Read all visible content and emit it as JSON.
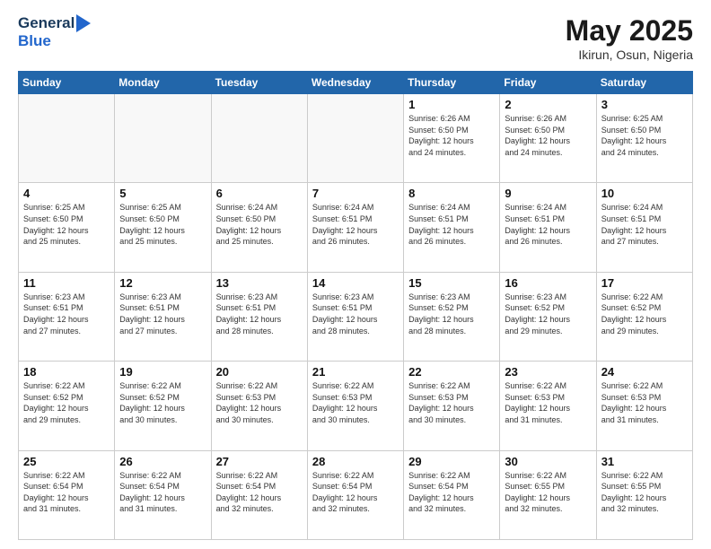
{
  "header": {
    "logo_general": "General",
    "logo_blue": "Blue",
    "month": "May 2025",
    "location": "Ikirun, Osun, Nigeria"
  },
  "days": [
    "Sunday",
    "Monday",
    "Tuesday",
    "Wednesday",
    "Thursday",
    "Friday",
    "Saturday"
  ],
  "weeks": [
    [
      {
        "date": "",
        "info": ""
      },
      {
        "date": "",
        "info": ""
      },
      {
        "date": "",
        "info": ""
      },
      {
        "date": "",
        "info": ""
      },
      {
        "date": "1",
        "info": "Sunrise: 6:26 AM\nSunset: 6:50 PM\nDaylight: 12 hours\nand 24 minutes."
      },
      {
        "date": "2",
        "info": "Sunrise: 6:26 AM\nSunset: 6:50 PM\nDaylight: 12 hours\nand 24 minutes."
      },
      {
        "date": "3",
        "info": "Sunrise: 6:25 AM\nSunset: 6:50 PM\nDaylight: 12 hours\nand 24 minutes."
      }
    ],
    [
      {
        "date": "4",
        "info": "Sunrise: 6:25 AM\nSunset: 6:50 PM\nDaylight: 12 hours\nand 25 minutes."
      },
      {
        "date": "5",
        "info": "Sunrise: 6:25 AM\nSunset: 6:50 PM\nDaylight: 12 hours\nand 25 minutes."
      },
      {
        "date": "6",
        "info": "Sunrise: 6:24 AM\nSunset: 6:50 PM\nDaylight: 12 hours\nand 25 minutes."
      },
      {
        "date": "7",
        "info": "Sunrise: 6:24 AM\nSunset: 6:51 PM\nDaylight: 12 hours\nand 26 minutes."
      },
      {
        "date": "8",
        "info": "Sunrise: 6:24 AM\nSunset: 6:51 PM\nDaylight: 12 hours\nand 26 minutes."
      },
      {
        "date": "9",
        "info": "Sunrise: 6:24 AM\nSunset: 6:51 PM\nDaylight: 12 hours\nand 26 minutes."
      },
      {
        "date": "10",
        "info": "Sunrise: 6:24 AM\nSunset: 6:51 PM\nDaylight: 12 hours\nand 27 minutes."
      }
    ],
    [
      {
        "date": "11",
        "info": "Sunrise: 6:23 AM\nSunset: 6:51 PM\nDaylight: 12 hours\nand 27 minutes."
      },
      {
        "date": "12",
        "info": "Sunrise: 6:23 AM\nSunset: 6:51 PM\nDaylight: 12 hours\nand 27 minutes."
      },
      {
        "date": "13",
        "info": "Sunrise: 6:23 AM\nSunset: 6:51 PM\nDaylight: 12 hours\nand 28 minutes."
      },
      {
        "date": "14",
        "info": "Sunrise: 6:23 AM\nSunset: 6:51 PM\nDaylight: 12 hours\nand 28 minutes."
      },
      {
        "date": "15",
        "info": "Sunrise: 6:23 AM\nSunset: 6:52 PM\nDaylight: 12 hours\nand 28 minutes."
      },
      {
        "date": "16",
        "info": "Sunrise: 6:23 AM\nSunset: 6:52 PM\nDaylight: 12 hours\nand 29 minutes."
      },
      {
        "date": "17",
        "info": "Sunrise: 6:22 AM\nSunset: 6:52 PM\nDaylight: 12 hours\nand 29 minutes."
      }
    ],
    [
      {
        "date": "18",
        "info": "Sunrise: 6:22 AM\nSunset: 6:52 PM\nDaylight: 12 hours\nand 29 minutes."
      },
      {
        "date": "19",
        "info": "Sunrise: 6:22 AM\nSunset: 6:52 PM\nDaylight: 12 hours\nand 30 minutes."
      },
      {
        "date": "20",
        "info": "Sunrise: 6:22 AM\nSunset: 6:53 PM\nDaylight: 12 hours\nand 30 minutes."
      },
      {
        "date": "21",
        "info": "Sunrise: 6:22 AM\nSunset: 6:53 PM\nDaylight: 12 hours\nand 30 minutes."
      },
      {
        "date": "22",
        "info": "Sunrise: 6:22 AM\nSunset: 6:53 PM\nDaylight: 12 hours\nand 30 minutes."
      },
      {
        "date": "23",
        "info": "Sunrise: 6:22 AM\nSunset: 6:53 PM\nDaylight: 12 hours\nand 31 minutes."
      },
      {
        "date": "24",
        "info": "Sunrise: 6:22 AM\nSunset: 6:53 PM\nDaylight: 12 hours\nand 31 minutes."
      }
    ],
    [
      {
        "date": "25",
        "info": "Sunrise: 6:22 AM\nSunset: 6:54 PM\nDaylight: 12 hours\nand 31 minutes."
      },
      {
        "date": "26",
        "info": "Sunrise: 6:22 AM\nSunset: 6:54 PM\nDaylight: 12 hours\nand 31 minutes."
      },
      {
        "date": "27",
        "info": "Sunrise: 6:22 AM\nSunset: 6:54 PM\nDaylight: 12 hours\nand 32 minutes."
      },
      {
        "date": "28",
        "info": "Sunrise: 6:22 AM\nSunset: 6:54 PM\nDaylight: 12 hours\nand 32 minutes."
      },
      {
        "date": "29",
        "info": "Sunrise: 6:22 AM\nSunset: 6:54 PM\nDaylight: 12 hours\nand 32 minutes."
      },
      {
        "date": "30",
        "info": "Sunrise: 6:22 AM\nSunset: 6:55 PM\nDaylight: 12 hours\nand 32 minutes."
      },
      {
        "date": "31",
        "info": "Sunrise: 6:22 AM\nSunset: 6:55 PM\nDaylight: 12 hours\nand 32 minutes."
      }
    ]
  ]
}
